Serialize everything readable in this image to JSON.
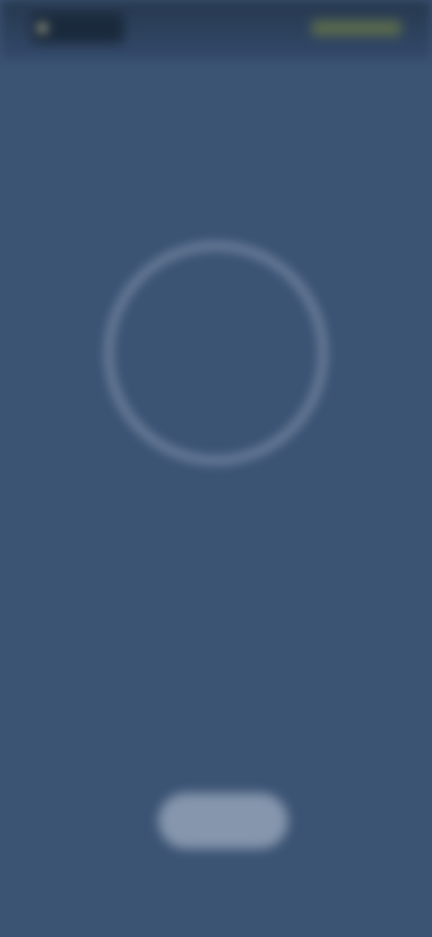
{
  "status_bar": {
    "time": "",
    "indicators": ""
  },
  "header": {
    "title": ""
  },
  "progress_ring": {
    "value": "",
    "caption": ""
  },
  "message": {
    "line1": "",
    "line2": "",
    "emphasis": ""
  },
  "action": {
    "button_label": ""
  },
  "colors": {
    "background": "#3c5474",
    "status_bar": "#26384e",
    "ring_stroke": "#c8d6e8",
    "button": "#8596ad"
  }
}
